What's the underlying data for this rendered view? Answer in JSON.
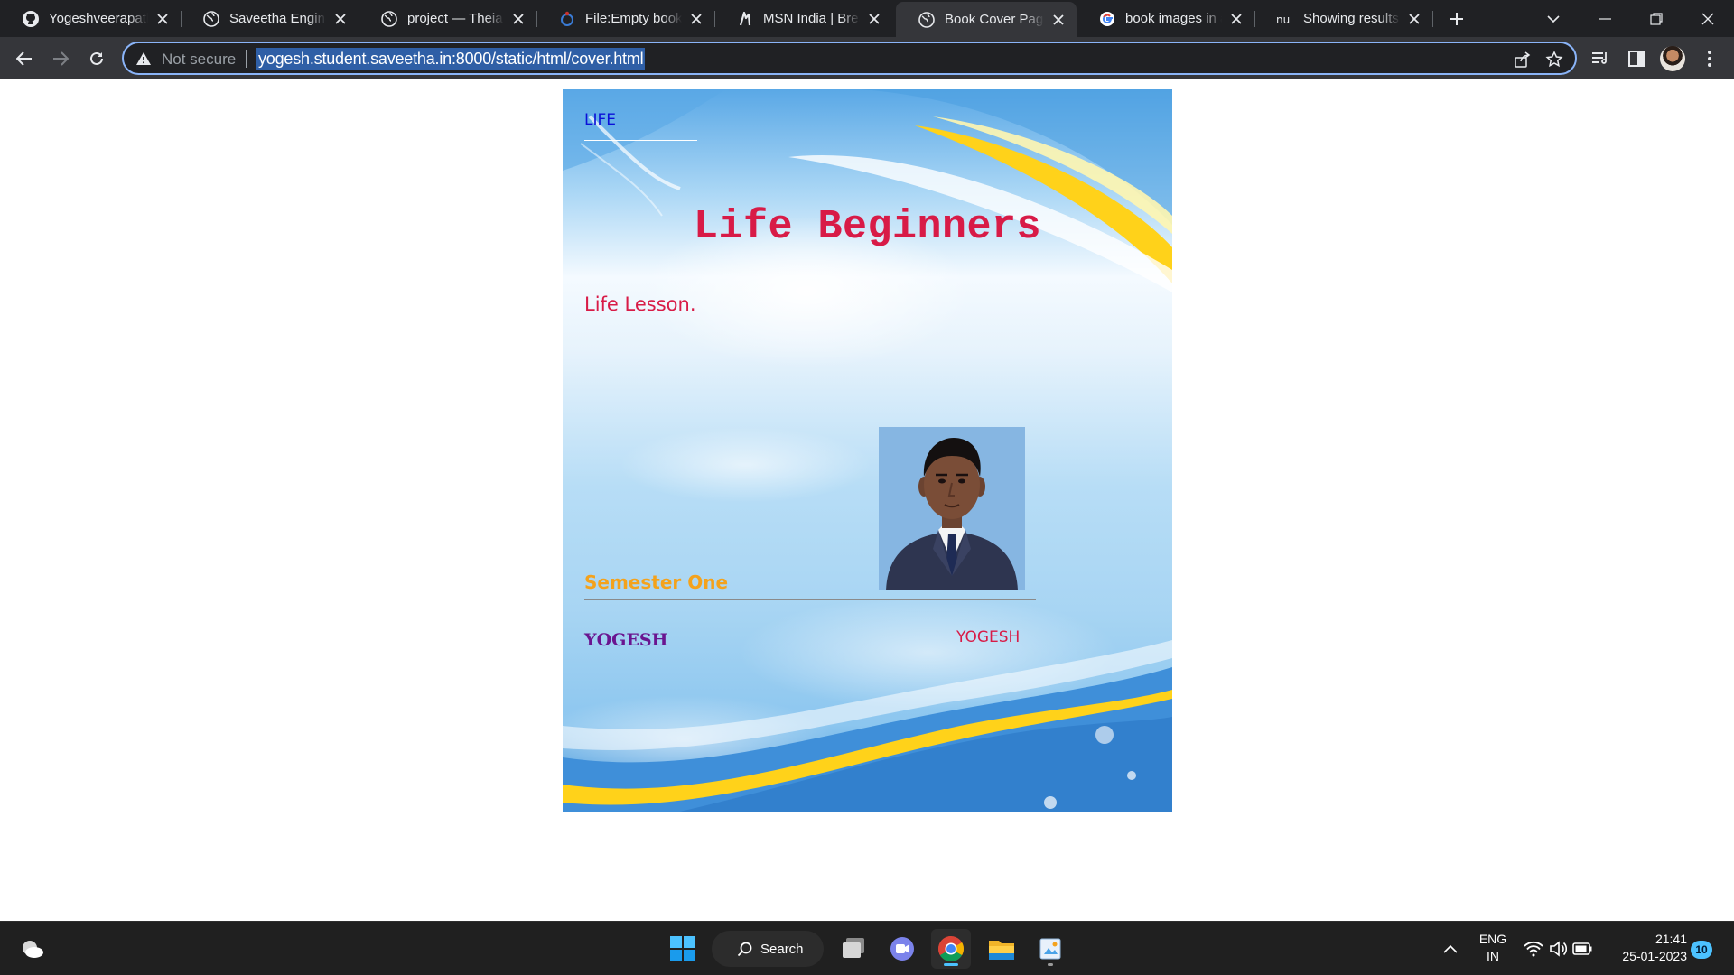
{
  "browser": {
    "tabs": [
      {
        "title": "Yogeshveerapathi",
        "icon": "github-icon"
      },
      {
        "title": "Saveetha Engineering College",
        "icon": "globe-icon"
      },
      {
        "title": "project — Theia Theia",
        "icon": "globe-icon"
      },
      {
        "title": "File:Empty book.jpg",
        "icon": "wikimedia-icon"
      },
      {
        "title": "MSN India | Breaking News",
        "icon": "msn-icon"
      },
      {
        "title": "Book Cover Page",
        "icon": "globe-icon",
        "active": true
      },
      {
        "title": "book images in ai",
        "icon": "google-icon"
      },
      {
        "title": "Showing results for",
        "icon": "nu-icon"
      }
    ],
    "omnibox": {
      "security_label": "Not secure",
      "url": "yogesh.student.saveetha.in:8000/static/html/cover.html"
    }
  },
  "cover": {
    "top_label": "LIFE",
    "title": "Life Beginners",
    "subtitle": "Life Lesson.",
    "semester": "Semester One",
    "author_left": "YOGESH",
    "author_right": "YOGESH",
    "colors": {
      "title": "#d81b47",
      "top_label": "#0b10d8",
      "semester": "#f4a21c",
      "author_left": "#6a1590"
    }
  },
  "taskbar": {
    "search_label": "Search",
    "language": {
      "line1": "ENG",
      "line2": "IN"
    },
    "time": "21:41",
    "date": "25-01-2023",
    "notification_count": "10"
  }
}
